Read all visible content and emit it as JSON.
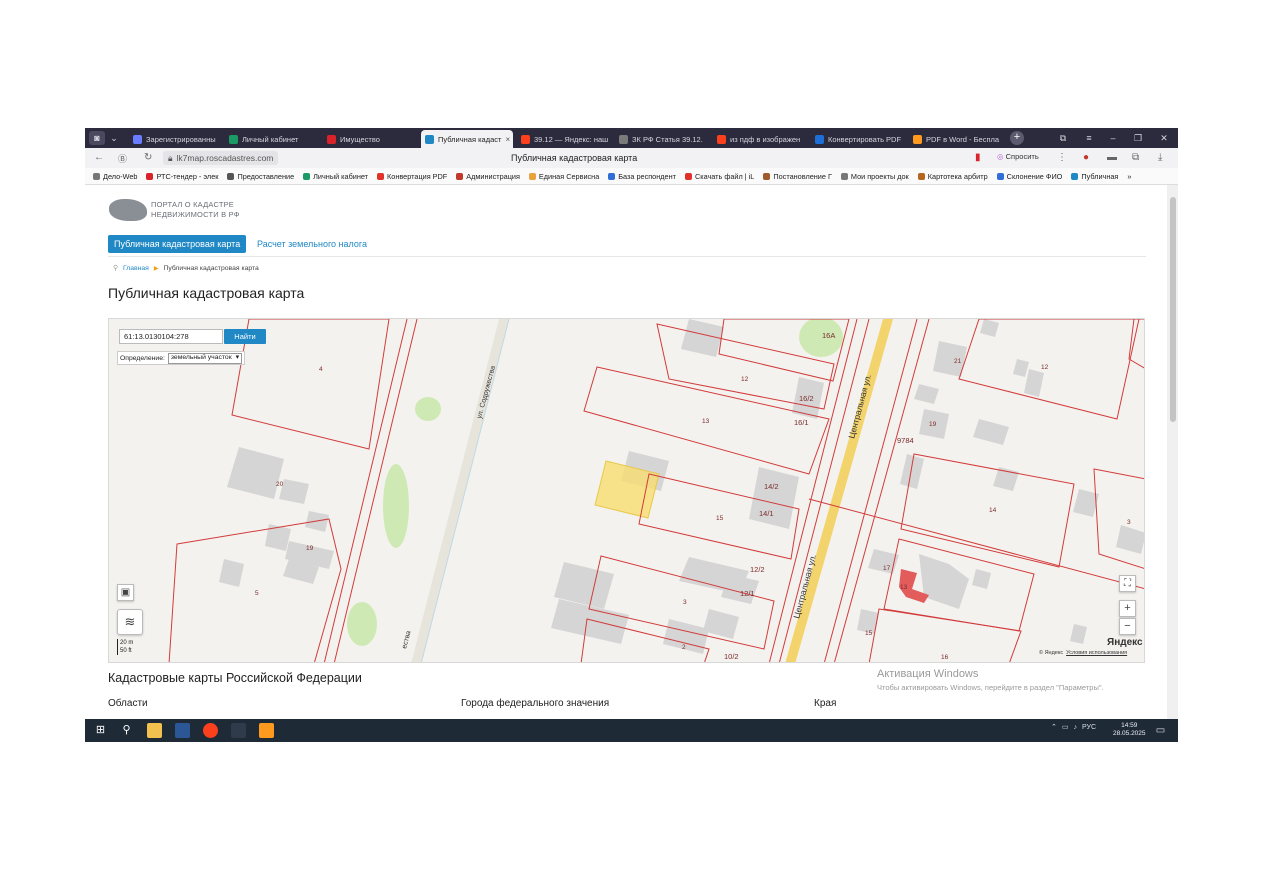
{
  "browser": {
    "tabs": [
      {
        "label": "Зарегистрированны",
        "icon": "user-icon",
        "color": "#6a7cff"
      },
      {
        "label": "Личный кабинет",
        "icon": "gosuslugi-icon",
        "color": "#1b9a66"
      },
      {
        "label": "Имущество",
        "icon": "rts-icon",
        "color": "#d9232a"
      },
      {
        "label": "Публичная кадаст",
        "icon": "rosreestr-icon",
        "color": "#1f88c5",
        "active": true
      },
      {
        "label": "39.12 — Яндекс: наш",
        "icon": "yandex-icon",
        "color": "#fc3f1d"
      },
      {
        "label": "ЗК РФ Статья 39.12.",
        "icon": "consultant-icon",
        "color": "#7a7a7a"
      },
      {
        "label": "из пдф в изображен",
        "icon": "yandex-icon",
        "color": "#fc3f1d"
      },
      {
        "label": "Конвертировать PDF",
        "icon": "convert-icon",
        "color": "#1b6fd6"
      },
      {
        "label": "PDF в Word - Беспла",
        "icon": "pdf-icon",
        "color": "#ff9a1f"
      }
    ],
    "tab_close": "×",
    "new_tab": "+",
    "window_controls": {
      "collections": "⧉",
      "menu": "≡",
      "minimize": "–",
      "restore": "❐",
      "close": "✕"
    },
    "url": "lk7map.roscadastres.com",
    "page_title": "Публичная кадастровая карта",
    "ask_label": "Спросить",
    "bookmarks": [
      {
        "label": "Дело-Web",
        "icon": "doc-icon",
        "color": "#777777"
      },
      {
        "label": "РТС-тендер - элек",
        "icon": "rts-icon",
        "color": "#d9232a"
      },
      {
        "label": "Предоставление",
        "icon": "globe-icon",
        "color": "#555555"
      },
      {
        "label": "Личный кабинет",
        "icon": "gosuslugi-icon",
        "color": "#1b9a66"
      },
      {
        "label": "Конвертация PDF",
        "icon": "heart-icon",
        "color": "#e0322a"
      },
      {
        "label": "Администрация",
        "icon": "admin-icon",
        "color": "#c0392b"
      },
      {
        "label": "Единая Сервисна",
        "icon": "service-icon",
        "color": "#e8a33d"
      },
      {
        "label": "База респондент",
        "icon": "db-icon",
        "color": "#2f6fd6"
      },
      {
        "label": "Скачать файл | iL",
        "icon": "heart-icon",
        "color": "#e0322a"
      },
      {
        "label": "Постановление Г",
        "icon": "stamp-icon",
        "color": "#a05a2c"
      },
      {
        "label": "Мои проекты док",
        "icon": "doc-icon",
        "color": "#777777"
      },
      {
        "label": "Картотека арбитр",
        "icon": "arbitr-icon",
        "color": "#b5651d"
      },
      {
        "label": "Склонение ФИО",
        "icon": "text-icon",
        "color": "#2f6fd6"
      },
      {
        "label": "Публичная",
        "icon": "rosreestr-icon",
        "color": "#1f88c5"
      }
    ],
    "bookmarks_more": "»"
  },
  "page": {
    "logo_line1": "ПОРТАЛ О КАДАСТРЕ",
    "logo_line2": "НЕДВИЖИМОСТИ В РФ",
    "nav_active": "Публичная кадастровая карта",
    "nav_tax": "Расчет земельного налога",
    "breadcrumb_home": "Главная",
    "breadcrumb_current": "Публичная кадастровая карта",
    "heading": "Публичная кадастровая карта",
    "section_heading": "Кадастровые карты Российской Федерации",
    "columns": [
      "Области",
      "Города федерального значения",
      "Края"
    ]
  },
  "map": {
    "search_value": "61:13.0130104:278",
    "search_button": "Найти",
    "definition_label": "Определение:",
    "definition_value": "земельный участок",
    "scale_m": "20 m",
    "scale_ft": "50 ft",
    "yandex_logo": "Яндекс",
    "copyright": "© Яндекс",
    "terms": "Условия использования",
    "zoom_in": "+",
    "zoom_out": "−",
    "fullscreen": "⛶",
    "streets": [
      "ул. Содружества",
      "Центральная ул.",
      "Центральная ул.",
      "ества"
    ],
    "parcel_labels": [
      "4",
      "20",
      "19",
      "5",
      "12",
      "13",
      "16/2",
      "16/1",
      "14/2",
      "14/1",
      "15",
      "12/2",
      "12/1",
      "3",
      "2",
      "10/2",
      "16А",
      "21",
      "12",
      "19",
      "9784",
      "14",
      "3",
      "17",
      "13",
      "15",
      "16"
    ],
    "colors": {
      "parcel": "#d23b3b",
      "selected": "#f7dc6f",
      "road": "#f3d36b",
      "green": "#cfe9b4",
      "building": "#d5d5d5"
    }
  },
  "watermark": {
    "line1": "Активация Windows",
    "line2": "Чтобы активировать Windows, перейдите в раздел \"Параметры\"."
  },
  "taskbar": {
    "apps": [
      {
        "name": "file-explorer-icon",
        "color": "#f2c14e"
      },
      {
        "name": "word-icon",
        "color": "#2b5797"
      },
      {
        "name": "yandex-browser-icon",
        "color": "#fc3f1d"
      },
      {
        "name": "cryptopro-icon",
        "color": "#2f3b4a"
      },
      {
        "name": "mail-icon",
        "color": "#ff9a1f"
      }
    ],
    "language": "РУС",
    "time": "14:59",
    "date": "28.05.2025"
  }
}
